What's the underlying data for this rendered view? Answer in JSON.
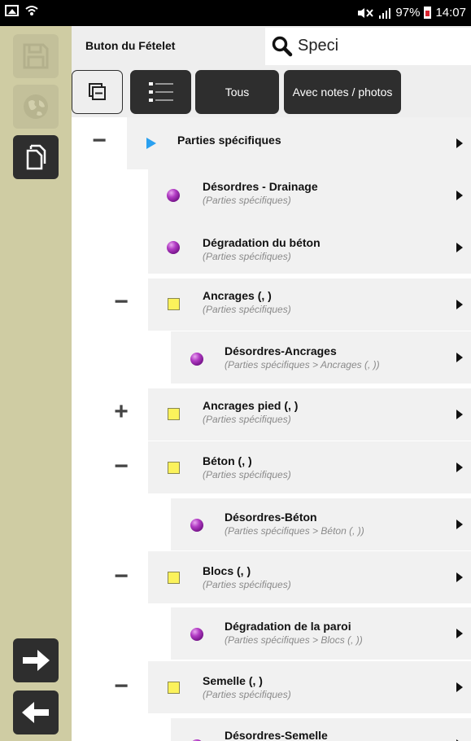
{
  "status_bar": {
    "battery": "97%",
    "time": "14:07"
  },
  "header": {
    "title": "Buton du Fételet",
    "search_value": "Speci"
  },
  "toolbar": {
    "all_label": "Tous",
    "notes_label": "Avec notes / photos"
  },
  "tree": {
    "root": {
      "label": "Parties spécifiques",
      "toggle": "−"
    },
    "items": [
      {
        "label": "Désordres - Drainage",
        "path": "(Parties spécifiques)",
        "icon": "ball"
      },
      {
        "label": "Dégradation du béton",
        "path": "(Parties spécifiques)",
        "icon": "ball"
      },
      {
        "label": "Ancrages (, )",
        "path": "(Parties spécifiques)",
        "icon": "square",
        "toggle": "−"
      },
      {
        "label": "Désordres-Ancrages",
        "path": "(Parties spécifiques > Ancrages (, ))",
        "icon": "ball"
      },
      {
        "label": "Ancrages pied (, )",
        "path": "(Parties spécifiques)",
        "icon": "square",
        "toggle": "+"
      },
      {
        "label": "Béton (, )",
        "path": "(Parties spécifiques)",
        "icon": "square",
        "toggle": "−"
      },
      {
        "label": "Désordres-Béton",
        "path": "(Parties spécifiques > Béton (, ))",
        "icon": "ball"
      },
      {
        "label": "Blocs (, )",
        "path": "(Parties spécifiques)",
        "icon": "square",
        "toggle": "−"
      },
      {
        "label": "Dégradation de la paroi",
        "path": "(Parties spécifiques > Blocs (, ))",
        "icon": "ball"
      },
      {
        "label": "Semelle (, )",
        "path": "(Parties spécifiques)",
        "icon": "square",
        "toggle": "−"
      },
      {
        "label": "Désordres-Semelle",
        "icon": "ball"
      }
    ]
  },
  "colors": {
    "sidebar": "#cfcca3",
    "button_dark": "#2e2e2e",
    "toolbar_bg": "#eeeeee",
    "row_bg": "#f1f1f1",
    "folder_yellow": "#fbf25b",
    "item_purple": "#9b2ab0",
    "root_blue": "#2aa0f0"
  },
  "icons": [
    "save-icon",
    "globe-icon",
    "copy-icon",
    "arrow-right-icon",
    "arrow-left-icon",
    "search-icon",
    "collapse-icon",
    "list-icon"
  ]
}
